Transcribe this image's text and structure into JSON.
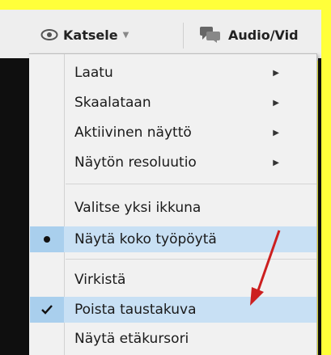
{
  "colors": {
    "frame_highlight": "#ffff3a",
    "menu_background": "#f1f1f1",
    "selected_background": "#c8e0f4",
    "annotation_arrow": "#cc1f1f"
  },
  "toolbar": {
    "view_label": "Katsele",
    "view_icon": "eye-icon",
    "audio_label": "Audio/Vid",
    "audio_icon": "chat-bubbles-icon"
  },
  "menu": {
    "items": [
      {
        "label": "Laatu",
        "has_submenu": true,
        "mark": ""
      },
      {
        "label": "Skaalataan",
        "has_submenu": true,
        "mark": ""
      },
      {
        "label": "Aktiivinen näyttö",
        "has_submenu": true,
        "mark": ""
      },
      {
        "label": "Näytön resoluutio",
        "has_submenu": true,
        "mark": ""
      },
      {
        "label": "Valitse yksi ikkuna",
        "has_submenu": false,
        "mark": ""
      },
      {
        "label": "Näytä koko työpöytä",
        "has_submenu": false,
        "mark": "bullet"
      },
      {
        "label": "Virkistä",
        "has_submenu": false,
        "mark": ""
      },
      {
        "label": "Poista taustakuva",
        "has_submenu": false,
        "mark": "check",
        "selected": true
      },
      {
        "label": "Näytä etäkursori",
        "has_submenu": false,
        "mark": ""
      }
    ]
  }
}
